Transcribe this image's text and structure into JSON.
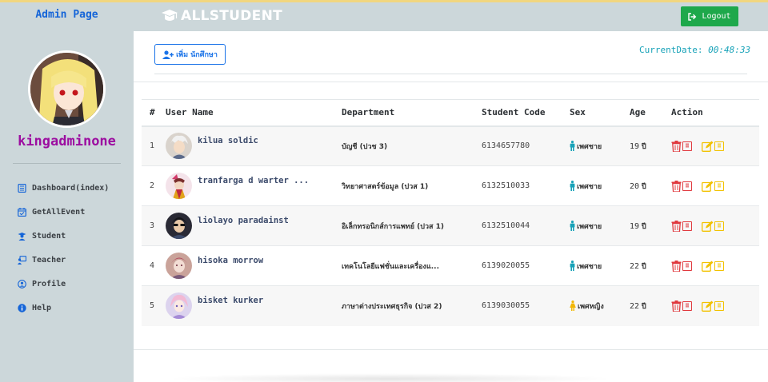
{
  "sidebar": {
    "title": "Admin Page",
    "username": "kingadminone",
    "menu": [
      {
        "label": "Dashboard(index)",
        "icon": "dashboard-icon"
      },
      {
        "label": "GetAllEvent",
        "icon": "calendar-check-icon"
      },
      {
        "label": "Student",
        "icon": "student-icon"
      },
      {
        "label": "Teacher",
        "icon": "teacher-icon"
      },
      {
        "label": "Profile",
        "icon": "profile-icon"
      },
      {
        "label": "Help",
        "icon": "info-icon"
      }
    ]
  },
  "topbar": {
    "brand": "ALLSTUDENT",
    "logout_label": "Logout"
  },
  "main": {
    "add_button_label": "เพิ่ม นักศึกษา",
    "current_date_label": "CurrentDate:",
    "current_time": "00:48:33"
  },
  "table": {
    "headers": [
      "#",
      "User Name",
      "Department",
      "Student Code",
      "Sex",
      "Age",
      "Action"
    ],
    "age_unit": "ปี",
    "rows": [
      {
        "no": "1",
        "name": "kilua soldic",
        "department": "บัญชี (ปวช 3)",
        "code": "6134657780",
        "sex": "เพศชาย",
        "gender": "male",
        "age": "19"
      },
      {
        "no": "2",
        "name": "tranfarga d warter ...",
        "department": "วิทยาศาสตร์ข้อมูล (ปวส 1)",
        "code": "6132510033",
        "sex": "เพศชาย",
        "gender": "male",
        "age": "20"
      },
      {
        "no": "3",
        "name": "liolayo paradainst",
        "department": "อิเล็กทรอนิกส์การแพทย์ (ปวส 1)",
        "code": "6132510044",
        "sex": "เพศชาย",
        "gender": "male",
        "age": "19"
      },
      {
        "no": "4",
        "name": "hisoka morrow",
        "department": "เทคโนโลยีแฟชั่นและเครื่องแ...",
        "code": "6139020055",
        "sex": "เพศชาย",
        "gender": "male",
        "age": "22"
      },
      {
        "no": "5",
        "name": "bisket kurker",
        "department": "ภาษาต่างประเทศธุรกิจ (ปวส 2)",
        "code": "6139030055",
        "sex": "เพศหญิง",
        "gender": "female",
        "age": "22"
      }
    ]
  },
  "colors": {
    "accent_blue": "#1a73e8",
    "logout_green": "#1ea84b",
    "username_purple": "#9c0da0",
    "male_icon": "#17a2b8",
    "female_icon": "#f2b705",
    "delete_red": "#e0393e",
    "edit_yellow": "#f2c200"
  }
}
